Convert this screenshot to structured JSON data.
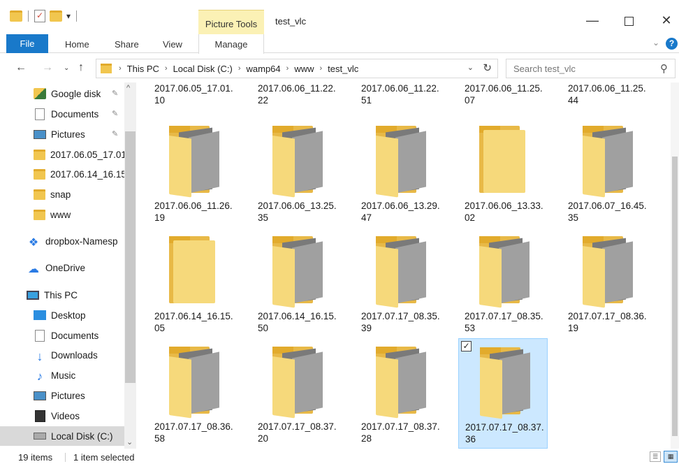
{
  "window": {
    "title": "test_vlc",
    "context_tab_group": "Picture Tools"
  },
  "ribbon": {
    "tabs": [
      "File",
      "Home",
      "Share",
      "View",
      "Manage"
    ]
  },
  "address": {
    "crumbs": [
      "This PC",
      "Local Disk (C:)",
      "wamp64",
      "www",
      "test_vlc"
    ]
  },
  "search": {
    "placeholder": "Search test_vlc"
  },
  "sidebar": {
    "items": [
      {
        "label": "Google disk",
        "icon": "google-drive-icon",
        "pinned": true
      },
      {
        "label": "Documents",
        "icon": "documents-icon",
        "pinned": true
      },
      {
        "label": "Pictures",
        "icon": "pictures-icon",
        "pinned": true
      },
      {
        "label": "2017.06.05_17.01",
        "icon": "folder-icon"
      },
      {
        "label": "2017.06.14_16.15",
        "icon": "folder-icon"
      },
      {
        "label": "snap",
        "icon": "folder-icon"
      },
      {
        "label": "www",
        "icon": "folder-icon"
      },
      {
        "label": "dropbox-Namesp",
        "icon": "dropbox-icon"
      },
      {
        "label": "OneDrive",
        "icon": "onedrive-icon"
      },
      {
        "label": "This PC",
        "icon": "this-pc-icon"
      },
      {
        "label": "Desktop",
        "icon": "desktop-icon"
      },
      {
        "label": "Documents",
        "icon": "documents-icon"
      },
      {
        "label": "Downloads",
        "icon": "downloads-icon"
      },
      {
        "label": "Music",
        "icon": "music-icon"
      },
      {
        "label": "Pictures",
        "icon": "pictures-icon"
      },
      {
        "label": "Videos",
        "icon": "videos-icon"
      },
      {
        "label": "Local Disk (C:)",
        "icon": "local-disk-icon",
        "selected": true
      }
    ]
  },
  "files": [
    {
      "line1": "2017.06.05_17.01.",
      "line2": "10",
      "thumb": "partial"
    },
    {
      "line1": "2017.06.06_11.22.",
      "line2": "22",
      "thumb": "partial"
    },
    {
      "line1": "2017.06.06_11.22.",
      "line2": "51",
      "thumb": "partial"
    },
    {
      "line1": "2017.06.06_11.25.",
      "line2": "07",
      "thumb": "partial"
    },
    {
      "line1": "2017.06.06_11.25.",
      "line2": "44",
      "thumb": "partial"
    },
    {
      "line1": "2017.06.06_11.26.",
      "line2": "19",
      "thumb": "photo"
    },
    {
      "line1": "2017.06.06_13.25.",
      "line2": "35",
      "thumb": "photo"
    },
    {
      "line1": "2017.06.06_13.29.",
      "line2": "47",
      "thumb": "photo"
    },
    {
      "line1": "2017.06.06_13.33.",
      "line2": "02",
      "thumb": "empty"
    },
    {
      "line1": "2017.06.07_16.45.",
      "line2": "35",
      "thumb": "photo"
    },
    {
      "line1": "2017.06.14_16.15.",
      "line2": "05",
      "thumb": "empty"
    },
    {
      "line1": "2017.06.14_16.15.",
      "line2": "50",
      "thumb": "photo"
    },
    {
      "line1": "2017.07.17_08.35.",
      "line2": "39",
      "thumb": "photo"
    },
    {
      "line1": "2017.07.17_08.35.",
      "line2": "53",
      "thumb": "photo"
    },
    {
      "line1": "2017.07.17_08.36.",
      "line2": "19",
      "thumb": "photo"
    },
    {
      "line1": "2017.07.17_08.36.",
      "line2": "58",
      "thumb": "photo"
    },
    {
      "line1": "2017.07.17_08.37.",
      "line2": "20",
      "thumb": "photo"
    },
    {
      "line1": "2017.07.17_08.37.",
      "line2": "28",
      "thumb": "photo"
    },
    {
      "line1": "2017.07.17_08.37.",
      "line2": "36",
      "thumb": "photo",
      "selected": true
    }
  ],
  "status": {
    "count": "19 items",
    "selection": "1 item selected"
  },
  "colors": {
    "accent": "#1979ca",
    "selection": "#cce8ff",
    "folder": "#f1c64f"
  }
}
